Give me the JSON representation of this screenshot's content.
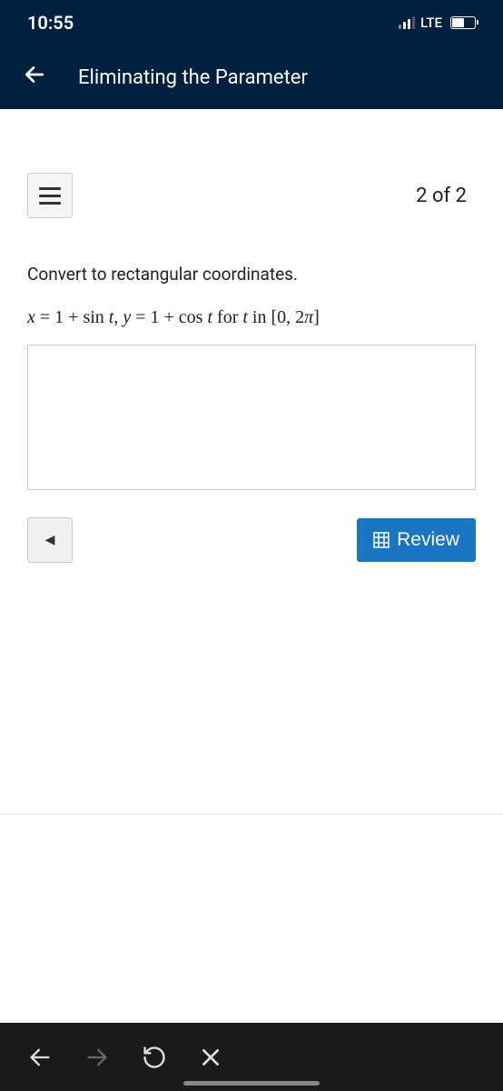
{
  "status_bar": {
    "time": "10:55",
    "network": "LTE"
  },
  "header": {
    "title": "Eliminating the Parameter"
  },
  "content": {
    "page_indicator": "2 of 2",
    "question_prompt": "Convert to rectangular coordinates.",
    "equation_x_var": "x",
    "equation_eq1": " = 1 + sin ",
    "equation_t1": "t",
    "equation_comma": ", ",
    "equation_y_var": "y",
    "equation_eq2": " = 1 + cos ",
    "equation_t2": "t",
    "equation_for": " for ",
    "equation_t3": "t",
    "equation_in": " in [0,  2",
    "equation_pi": "π",
    "equation_close": "]"
  },
  "controls": {
    "review_label": "Review"
  }
}
